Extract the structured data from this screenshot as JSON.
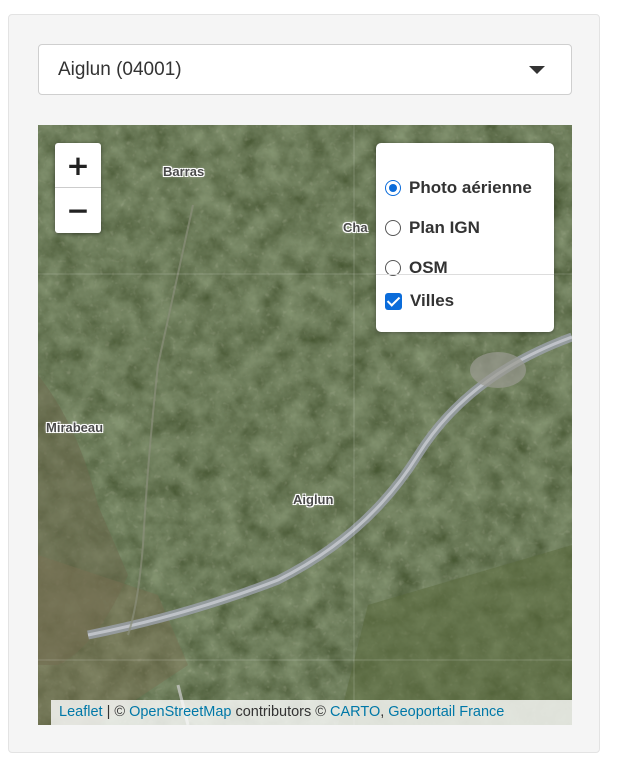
{
  "commune_select": {
    "selected": "Aiglun (04001)"
  },
  "map": {
    "zoom_in_label": "+",
    "zoom_out_label": "−",
    "towns": {
      "barras": "Barras",
      "cha": "Cha",
      "mirabeau": "Mirabeau",
      "aiglun": "Aiglun"
    },
    "layers": {
      "base": [
        {
          "label": "Photo aérienne",
          "checked": true
        },
        {
          "label": "Plan IGN",
          "checked": false
        },
        {
          "label": "OSM",
          "checked": false
        }
      ],
      "overlays": [
        {
          "label": "Villes",
          "checked": true
        }
      ]
    },
    "attribution": {
      "leaflet": "Leaflet",
      "separator": " | © ",
      "osm": "OpenStreetMap",
      "contributors": " contributors © ",
      "carto": "CARTO",
      "comma": ", ",
      "geoportail": "Geoportail France"
    }
  },
  "colors": {
    "accent": "#0b6cda",
    "link": "#0078a8",
    "panel_bg": "#f5f5f5"
  },
  "icons": {
    "select_caret": "caret-down-icon",
    "check": "checkmark-icon"
  }
}
